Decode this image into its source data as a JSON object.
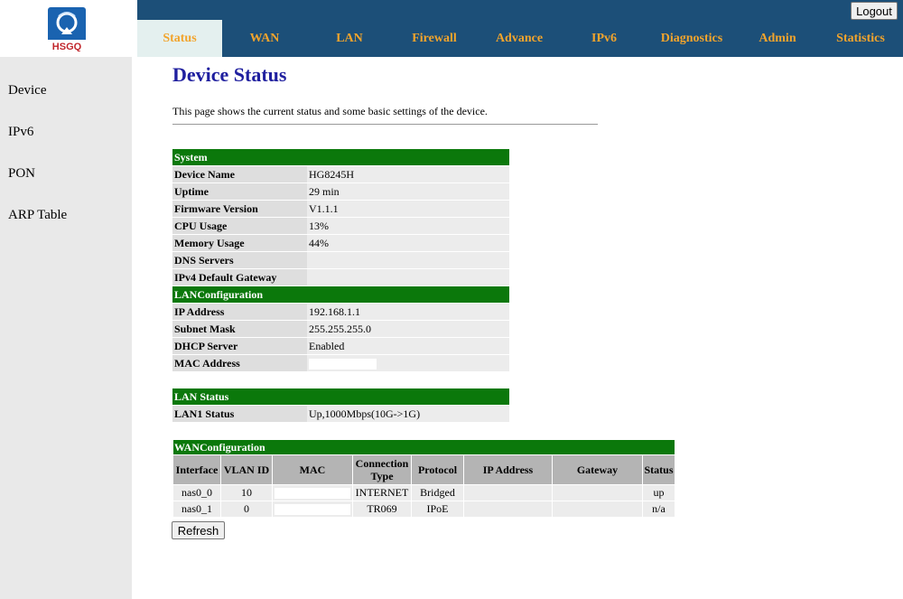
{
  "brand": {
    "logo_text": "HSGQ"
  },
  "header": {
    "logout_label": "Logout"
  },
  "nav": {
    "tabs": [
      "Status",
      "WAN",
      "LAN",
      "Firewall",
      "Advance",
      "IPv6",
      "Diagnostics",
      "Admin",
      "Statistics"
    ],
    "active": "Status"
  },
  "sidebar": {
    "items": [
      "Device",
      "IPv6",
      "PON",
      "ARP Table"
    ]
  },
  "page": {
    "title": "Device Status",
    "description": "This page shows the current status and some basic settings of the device."
  },
  "system": {
    "header": "System",
    "rows": [
      {
        "label": "Device Name",
        "value": "HG8245H"
      },
      {
        "label": "Uptime",
        "value": "29 min"
      },
      {
        "label": "Firmware Version",
        "value": "V1.1.1"
      },
      {
        "label": "CPU Usage",
        "value": "13%"
      },
      {
        "label": "Memory Usage",
        "value": "44%"
      },
      {
        "label": "DNS Servers",
        "value": ""
      },
      {
        "label": "IPv4 Default Gateway",
        "value": ""
      }
    ]
  },
  "lan_config": {
    "header": "LANConfiguration",
    "rows": [
      {
        "label": "IP Address",
        "value": "192.168.1.1"
      },
      {
        "label": "Subnet Mask",
        "value": "255.255.255.0"
      },
      {
        "label": "DHCP Server",
        "value": "Enabled"
      },
      {
        "label": "MAC Address",
        "value": ""
      }
    ]
  },
  "lan_status": {
    "header": "LAN Status",
    "rows": [
      {
        "label": "LAN1 Status",
        "value": "Up,1000Mbps(10G->1G)"
      }
    ]
  },
  "wan_config": {
    "header": "WANConfiguration",
    "columns": [
      "Interface",
      "VLAN ID",
      "MAC",
      "Connection Type",
      "Protocol",
      "IP Address",
      "Gateway",
      "Status"
    ],
    "rows": [
      {
        "interface": "nas0_0",
        "vlan": "10",
        "mac": "",
        "type": "INTERNET",
        "protocol": "Bridged",
        "ip": "",
        "gateway": "",
        "status": "up"
      },
      {
        "interface": "nas0_1",
        "vlan": "0",
        "mac": "",
        "type": "TR069",
        "protocol": "IPoE",
        "ip": "",
        "gateway": "",
        "status": "n/a"
      }
    ]
  },
  "actions": {
    "refresh_label": "Refresh"
  },
  "colors": {
    "nav_bg": "#1c4f78",
    "nav_text": "#f2a42c",
    "section_green": "#0b780b",
    "title_blue": "#1f1f9f"
  }
}
